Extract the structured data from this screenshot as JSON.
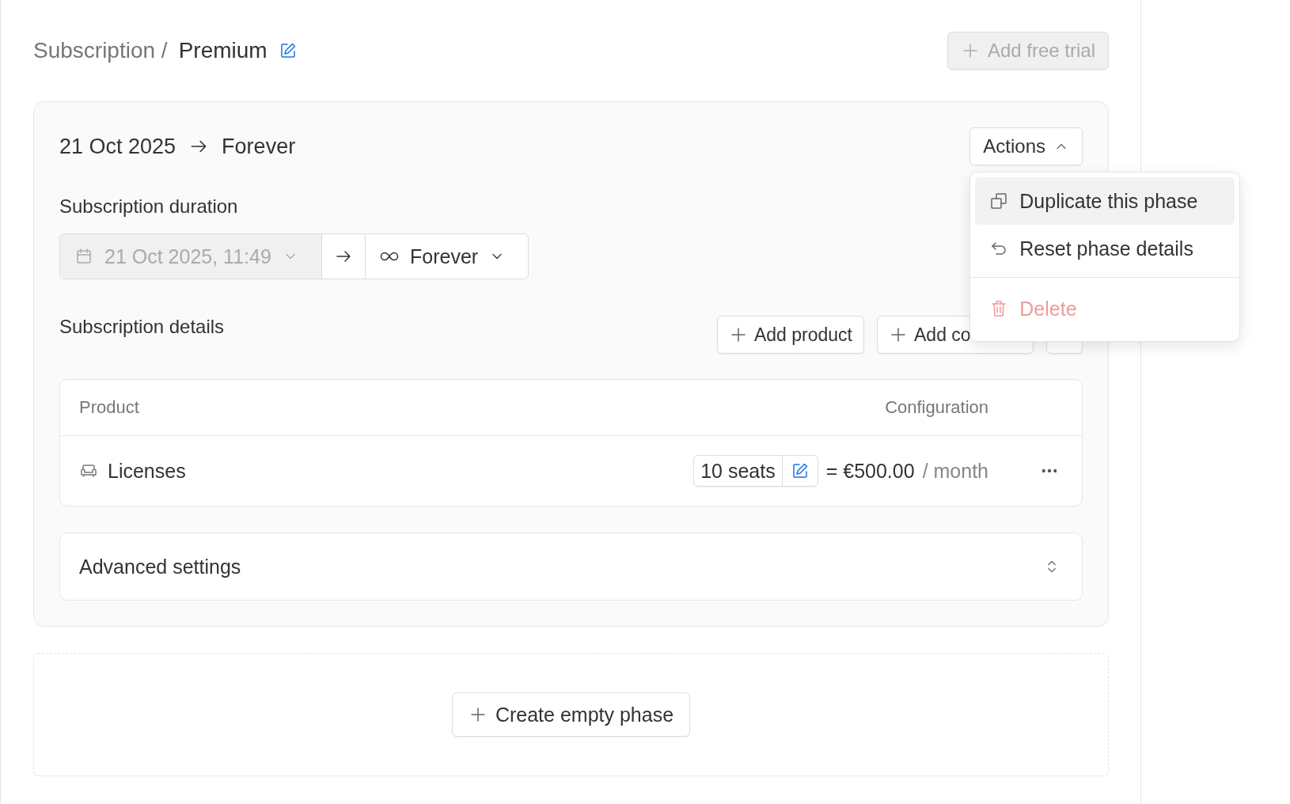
{
  "breadcrumb": {
    "parent": "Subscription /",
    "current": "Premium"
  },
  "header_button": {
    "label": "Add free trial",
    "disabled": true
  },
  "phase": {
    "start": "21 Oct 2025",
    "end": "Forever",
    "actions_button": {
      "label": "Actions",
      "expanded": true
    },
    "actions_menu": [
      {
        "kind": "duplicate",
        "label": "Duplicate this phase",
        "selected": true
      },
      {
        "kind": "reset",
        "label": "Reset phase details",
        "selected": false
      },
      {
        "kind": "delete",
        "label": "Delete",
        "selected": false
      }
    ],
    "duration": {
      "label": "Subscription duration",
      "start_value": "21 Oct 2025, 11:49",
      "start_disabled": true,
      "end_value": "Forever"
    },
    "details": {
      "label": "Subscription details",
      "buttons": [
        "Add product",
        "Add co"
      ]
    },
    "table": {
      "columns": [
        "Product",
        "Configuration"
      ],
      "rows": [
        {
          "product": "Licenses",
          "quantity": "10 seats",
          "price": "= €500.00",
          "period": "/ month"
        }
      ]
    },
    "advanced": {
      "label": "Advanced settings"
    }
  },
  "create_button": "Create empty phase"
}
